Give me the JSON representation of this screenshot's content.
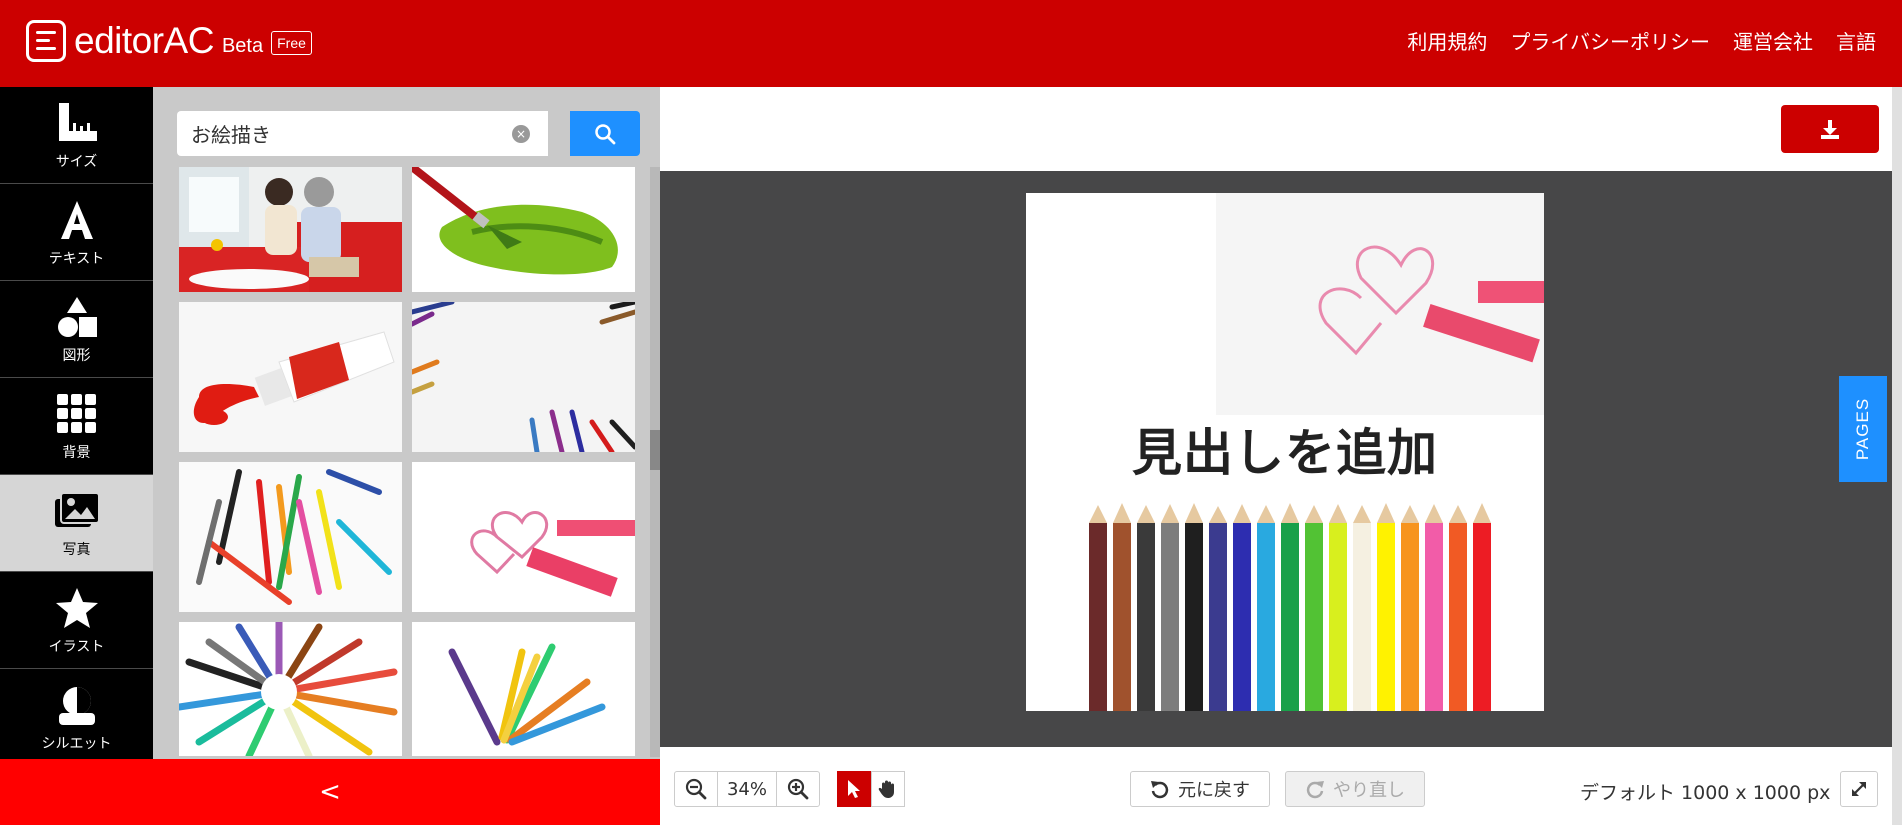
{
  "header": {
    "brand": "editorAC",
    "beta": "Beta",
    "free": "Free",
    "nav": [
      "利用規約",
      "プライバシーポリシー",
      "運営会社",
      "言語"
    ],
    "color": "#cc0000"
  },
  "toolbar": {
    "items": [
      {
        "label": "サイズ",
        "icon": "ruler-icon"
      },
      {
        "label": "テキスト",
        "icon": "text-icon"
      },
      {
        "label": "図形",
        "icon": "shapes-icon"
      },
      {
        "label": "背景",
        "icon": "grid-icon"
      },
      {
        "label": "写真",
        "icon": "photo-icon",
        "active": true
      },
      {
        "label": "イラスト",
        "icon": "star-icon"
      },
      {
        "label": "シルエット",
        "icon": "silhouette-icon"
      }
    ]
  },
  "search": {
    "value": "お絵描き"
  },
  "collapse": {
    "label": "<"
  },
  "canvas": {
    "headline": "見出しを追加",
    "pages_tab": "PAGES"
  },
  "bottom": {
    "zoom": "34%",
    "undo": "元に戻す",
    "redo": "やり直し",
    "size": "デフォルト 1000 x 1000 px"
  }
}
